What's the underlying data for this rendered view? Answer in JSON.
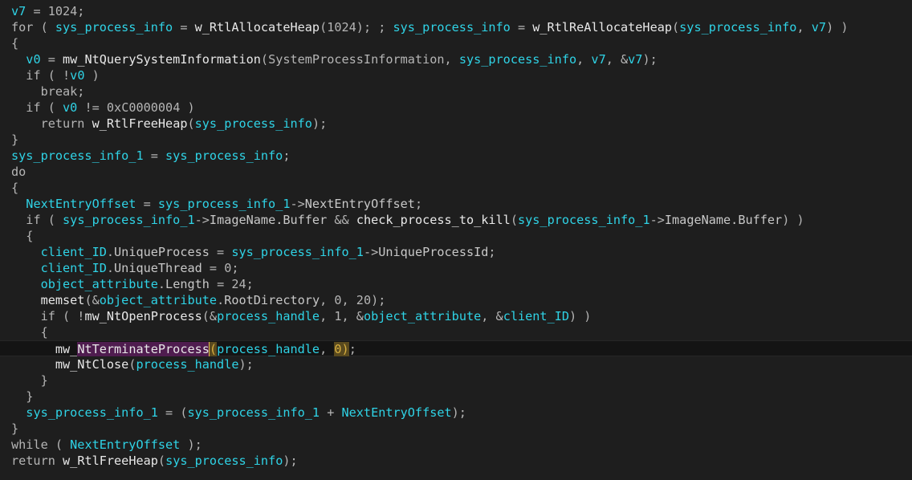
{
  "editor": {
    "current_line": 21,
    "lines": [
      [
        [
          "t-var",
          "v7"
        ],
        [
          "t-default",
          " = 1024;"
        ]
      ],
      [
        [
          "t-keyword",
          "for"
        ],
        [
          "t-default",
          " ( "
        ],
        [
          "t-var",
          "sys_process_info"
        ],
        [
          "t-default",
          " = "
        ],
        [
          "t-func",
          "w_RtlAllocateHeap"
        ],
        [
          "t-default",
          "(1024); ; "
        ],
        [
          "t-var",
          "sys_process_info"
        ],
        [
          "t-default",
          " = "
        ],
        [
          "t-func",
          "w_RtlReAllocateHeap"
        ],
        [
          "t-default",
          "("
        ],
        [
          "t-var",
          "sys_process_info"
        ],
        [
          "t-default",
          ", "
        ],
        [
          "t-var",
          "v7"
        ],
        [
          "t-default",
          ") )"
        ]
      ],
      [
        [
          "t-default",
          "{"
        ]
      ],
      [
        [
          "t-default",
          "  "
        ],
        [
          "t-var",
          "v0"
        ],
        [
          "t-default",
          " = "
        ],
        [
          "t-func",
          "mw_NtQuerySystemInformation"
        ],
        [
          "t-default",
          "(SystemProcessInformation, "
        ],
        [
          "t-var",
          "sys_process_info"
        ],
        [
          "t-default",
          ", "
        ],
        [
          "t-var",
          "v7"
        ],
        [
          "t-default",
          ", &"
        ],
        [
          "t-var",
          "v7"
        ],
        [
          "t-default",
          ");"
        ]
      ],
      [
        [
          "t-default",
          "  "
        ],
        [
          "t-keyword",
          "if"
        ],
        [
          "t-default",
          " ( !"
        ],
        [
          "t-var",
          "v0"
        ],
        [
          "t-default",
          " )"
        ]
      ],
      [
        [
          "t-default",
          "    "
        ],
        [
          "t-keyword",
          "break"
        ],
        [
          "t-default",
          ";"
        ]
      ],
      [
        [
          "t-default",
          "  "
        ],
        [
          "t-keyword",
          "if"
        ],
        [
          "t-default",
          " ( "
        ],
        [
          "t-var",
          "v0"
        ],
        [
          "t-default",
          " != 0xC0000004 )"
        ]
      ],
      [
        [
          "t-default",
          "    "
        ],
        [
          "t-keyword",
          "return"
        ],
        [
          "t-default",
          " "
        ],
        [
          "t-func",
          "w_RtlFreeHeap"
        ],
        [
          "t-default",
          "("
        ],
        [
          "t-var",
          "sys_process_info"
        ],
        [
          "t-default",
          ");"
        ]
      ],
      [
        [
          "t-default",
          "}"
        ]
      ],
      [
        [
          "t-var",
          "sys_process_info_1"
        ],
        [
          "t-default",
          " = "
        ],
        [
          "t-var",
          "sys_process_info"
        ],
        [
          "t-default",
          ";"
        ]
      ],
      [
        [
          "t-keyword",
          "do"
        ]
      ],
      [
        [
          "t-default",
          "{"
        ]
      ],
      [
        [
          "t-default",
          "  "
        ],
        [
          "t-var",
          "NextEntryOffset"
        ],
        [
          "t-default",
          " = "
        ],
        [
          "t-var",
          "sys_process_info_1"
        ],
        [
          "t-default",
          "->"
        ],
        [
          "t-member",
          "NextEntryOffset"
        ],
        [
          "t-default",
          ";"
        ]
      ],
      [
        [
          "t-default",
          "  "
        ],
        [
          "t-keyword",
          "if"
        ],
        [
          "t-default",
          " ( "
        ],
        [
          "t-var",
          "sys_process_info_1"
        ],
        [
          "t-default",
          "->"
        ],
        [
          "t-member",
          "ImageName.Buffer"
        ],
        [
          "t-default",
          " && "
        ],
        [
          "t-func",
          "check_process_to_kill"
        ],
        [
          "t-default",
          "("
        ],
        [
          "t-var",
          "sys_process_info_1"
        ],
        [
          "t-default",
          "->"
        ],
        [
          "t-member",
          "ImageName.Buffer"
        ],
        [
          "t-default",
          ") )"
        ]
      ],
      [
        [
          "t-default",
          "  {"
        ]
      ],
      [
        [
          "t-default",
          "    "
        ],
        [
          "t-var",
          "client_ID"
        ],
        [
          "t-default",
          "."
        ],
        [
          "t-member",
          "UniqueProcess"
        ],
        [
          "t-default",
          " = "
        ],
        [
          "t-var",
          "sys_process_info_1"
        ],
        [
          "t-default",
          "->"
        ],
        [
          "t-member",
          "UniqueProcessId"
        ],
        [
          "t-default",
          ";"
        ]
      ],
      [
        [
          "t-default",
          "    "
        ],
        [
          "t-var",
          "client_ID"
        ],
        [
          "t-default",
          "."
        ],
        [
          "t-member",
          "UniqueThread"
        ],
        [
          "t-default",
          " = 0;"
        ]
      ],
      [
        [
          "t-default",
          "    "
        ],
        [
          "t-var",
          "object_attribute"
        ],
        [
          "t-default",
          "."
        ],
        [
          "t-member",
          "Length"
        ],
        [
          "t-default",
          " = 24;"
        ]
      ],
      [
        [
          "t-default",
          "    "
        ],
        [
          "t-func",
          "memset"
        ],
        [
          "t-default",
          "(&"
        ],
        [
          "t-var",
          "object_attribute"
        ],
        [
          "t-default",
          "."
        ],
        [
          "t-member",
          "RootDirectory"
        ],
        [
          "t-default",
          ", 0, 20);"
        ]
      ],
      [
        [
          "t-default",
          "    "
        ],
        [
          "t-keyword",
          "if"
        ],
        [
          "t-default",
          " ( !"
        ],
        [
          "t-func",
          "mw_NtOpenProcess"
        ],
        [
          "t-default",
          "(&"
        ],
        [
          "t-var",
          "process_handle"
        ],
        [
          "t-default",
          ", 1, &"
        ],
        [
          "t-var",
          "object_attribute"
        ],
        [
          "t-default",
          ", &"
        ],
        [
          "t-var",
          "client_ID"
        ],
        [
          "t-default",
          ") )"
        ]
      ],
      [
        [
          "t-default",
          "    {"
        ]
      ],
      [
        [
          "t-default",
          "      "
        ],
        [
          "t-func",
          "mw_"
        ],
        [
          "t-hl-name",
          "NtTerminateProcess"
        ],
        [
          "caret",
          ""
        ],
        [
          "t-hl-brace",
          "("
        ],
        [
          "t-var",
          "process_handle"
        ],
        [
          "t-default",
          ", "
        ],
        [
          "t-hl-brace",
          "0"
        ],
        [
          "t-hl-brace",
          ")"
        ],
        [
          "t-default",
          ";"
        ]
      ],
      [
        [
          "t-default",
          "      "
        ],
        [
          "t-func",
          "mw_NtClose"
        ],
        [
          "t-default",
          "("
        ],
        [
          "t-var",
          "process_handle"
        ],
        [
          "t-default",
          ");"
        ]
      ],
      [
        [
          "t-default",
          "    }"
        ]
      ],
      [
        [
          "t-default",
          "  }"
        ]
      ],
      [
        [
          "t-default",
          "  "
        ],
        [
          "t-var",
          "sys_process_info_1"
        ],
        [
          "t-default",
          " = ("
        ],
        [
          "t-var",
          "sys_process_info_1"
        ],
        [
          "t-default",
          " + "
        ],
        [
          "t-var",
          "NextEntryOffset"
        ],
        [
          "t-default",
          ");"
        ]
      ],
      [
        [
          "t-default",
          "}"
        ]
      ],
      [
        [
          "t-keyword",
          "while"
        ],
        [
          "t-default",
          " ( "
        ],
        [
          "t-var",
          "NextEntryOffset"
        ],
        [
          "t-default",
          " );"
        ]
      ],
      [
        [
          "t-keyword",
          "return"
        ],
        [
          "t-default",
          " "
        ],
        [
          "t-func",
          "w_RtlFreeHeap"
        ],
        [
          "t-default",
          "("
        ],
        [
          "t-var",
          "sys_process_info"
        ],
        [
          "t-default",
          ");"
        ]
      ]
    ]
  }
}
